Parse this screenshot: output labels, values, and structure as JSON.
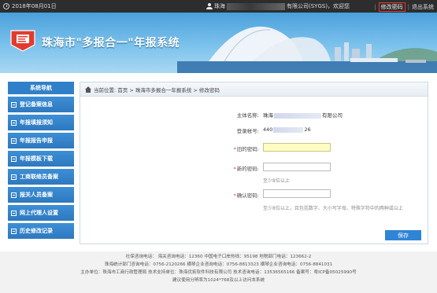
{
  "topbar": {
    "date": "2018年08月01日",
    "user_prefix": "珠海",
    "user_suffix": "有限公司(SYGS)，欢迎您",
    "sep": "|",
    "change_password": "修改密码",
    "logout": "退出系统"
  },
  "banner": {
    "title": "珠海市\"多报合一\"年报系统"
  },
  "sidebar": {
    "header": "系统导航",
    "items": [
      {
        "label": "登记备案信息"
      },
      {
        "label": "年报填报须知"
      },
      {
        "label": "年报报告申报"
      },
      {
        "label": "年报模板下载"
      },
      {
        "label": "工商联络员备案"
      },
      {
        "label": "报关人员备案"
      },
      {
        "label": "网上代理人设置"
      },
      {
        "label": "历史修改记录"
      }
    ]
  },
  "breadcrumb": {
    "text": "当前位置: 首页 > 珠海市多报合一年报系统 > 修改密码"
  },
  "form": {
    "entity_label": "主体名称:",
    "entity_prefix": "珠海",
    "entity_suffix": "有限公司",
    "account_label": "登录帐号:",
    "account_prefix": "440",
    "account_suffix": "26",
    "old_pwd_label": "旧的密码:",
    "new_pwd_label": "新的密码:",
    "new_pwd_hint": "至少8位以上",
    "confirm_label": "确认密码:",
    "confirm_hint": "至少8位以上，且包括数字、大小写字母、特殊字符中的两种或以上",
    "required_mark": "*",
    "save": "保存"
  },
  "footer": {
    "line1": "社保咨询电话： 海关咨询电话：12360 中国电子口岸热线：95198 地税部门电话：123662-2",
    "line2": "珠海统计部门咨询电话：0756-2120266 横琴企业咨询电话：0756-8813323 横琴企业咨询电话：0756-8841031",
    "line3": "主办单位：珠海市工商行政管理局 技术支持单位：珠海优拓软件科技有限公司 技术咨询电话：13536565166 备案号：粤ICP备05025990号",
    "line4": "建议使用分辨率为1024*768及以上访问本系统"
  },
  "colors": {
    "topbar": "#2d2d2d",
    "nav_blue": "#2f80c8",
    "save_blue": "#2f84d6",
    "focus_yellow": "#fffcc2",
    "required_red": "#e33333"
  },
  "icons": [
    "clock-icon",
    "user-icon",
    "logo-icon",
    "home-icon",
    "nav-item-icon"
  ]
}
